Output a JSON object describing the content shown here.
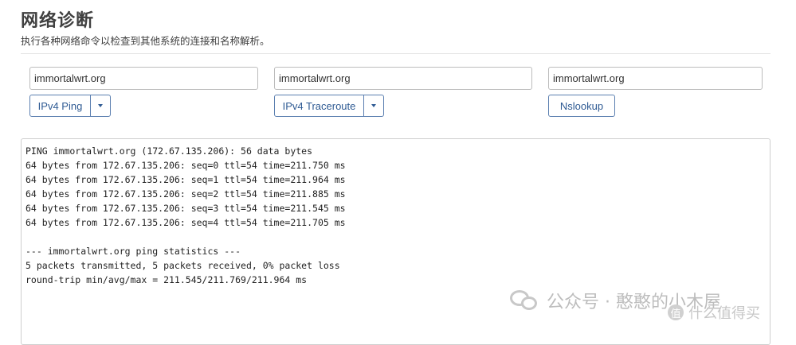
{
  "page": {
    "title": "网络诊断",
    "subtitle": "执行各种网络命令以检查到其他系统的连接和名称解析。"
  },
  "tools": [
    {
      "value": "immortalwrt.org",
      "button_label": "IPv4 Ping"
    },
    {
      "value": "immortalwrt.org",
      "button_label": "IPv4 Traceroute"
    },
    {
      "value": "immortalwrt.org",
      "button_label": "Nslookup"
    }
  ],
  "output": {
    "lines": [
      "PING immortalwrt.org (172.67.135.206): 56 data bytes",
      "64 bytes from 172.67.135.206: seq=0 ttl=54 time=211.750 ms",
      "64 bytes from 172.67.135.206: seq=1 ttl=54 time=211.964 ms",
      "64 bytes from 172.67.135.206: seq=2 ttl=54 time=211.885 ms",
      "64 bytes from 172.67.135.206: seq=3 ttl=54 time=211.545 ms",
      "64 bytes from 172.67.135.206: seq=4 ttl=54 time=211.705 ms",
      "",
      "--- immortalwrt.org ping statistics ---",
      "5 packets transmitted, 5 packets received, 0% packet loss",
      "round-trip min/avg/max = 211.545/211.769/211.964 ms"
    ]
  },
  "watermark": {
    "main_text": "公众号 · 憨憨的小木屋",
    "site_badge": "值",
    "site_text": "什么值得买"
  },
  "colors": {
    "button_border": "#5b7fb0",
    "button_text": "#2e5a93"
  },
  "icons": {
    "dropdown": "caret-down-icon",
    "watermark_logo": "wechat-icon"
  }
}
